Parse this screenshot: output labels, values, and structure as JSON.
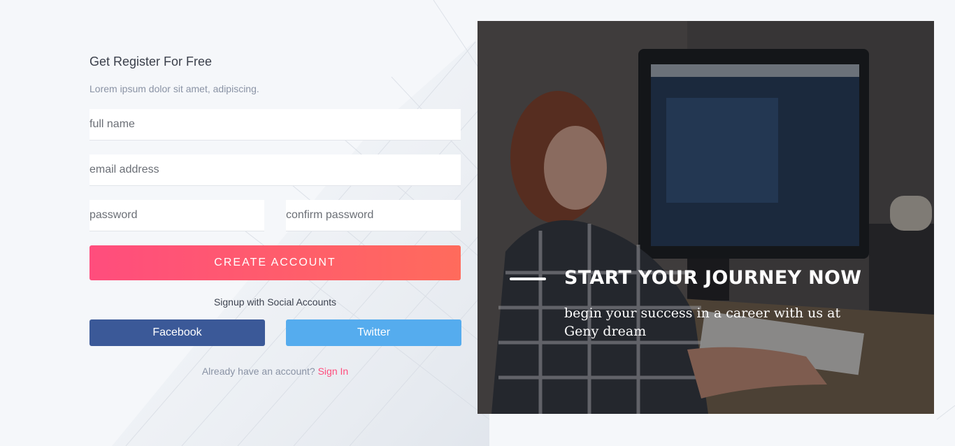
{
  "form": {
    "title": "Get Register For Free",
    "subtitle": "Lorem ipsum dolor sit amet, adipiscing.",
    "fields": {
      "full_name": {
        "placeholder": "full name",
        "value": ""
      },
      "email": {
        "placeholder": "email address",
        "value": ""
      },
      "password": {
        "placeholder": "password",
        "value": ""
      },
      "confirm_password": {
        "placeholder": "confirm password",
        "value": ""
      }
    },
    "create_button": "CREATE ACCOUNT",
    "social_label": "Signup with Social Accounts",
    "facebook_button": "Facebook",
    "twitter_button": "Twitter",
    "signin_prompt": "Already have an account?",
    "signin_link": "Sign In"
  },
  "hero": {
    "title": "START YOUR JOURNEY NOW",
    "subtitle": "begin your success in a career with us at Geny dream"
  },
  "colors": {
    "accent": "#ff4d7d",
    "accent_end": "#ff6b5c",
    "facebook": "#3b5998",
    "twitter": "#55acee"
  }
}
